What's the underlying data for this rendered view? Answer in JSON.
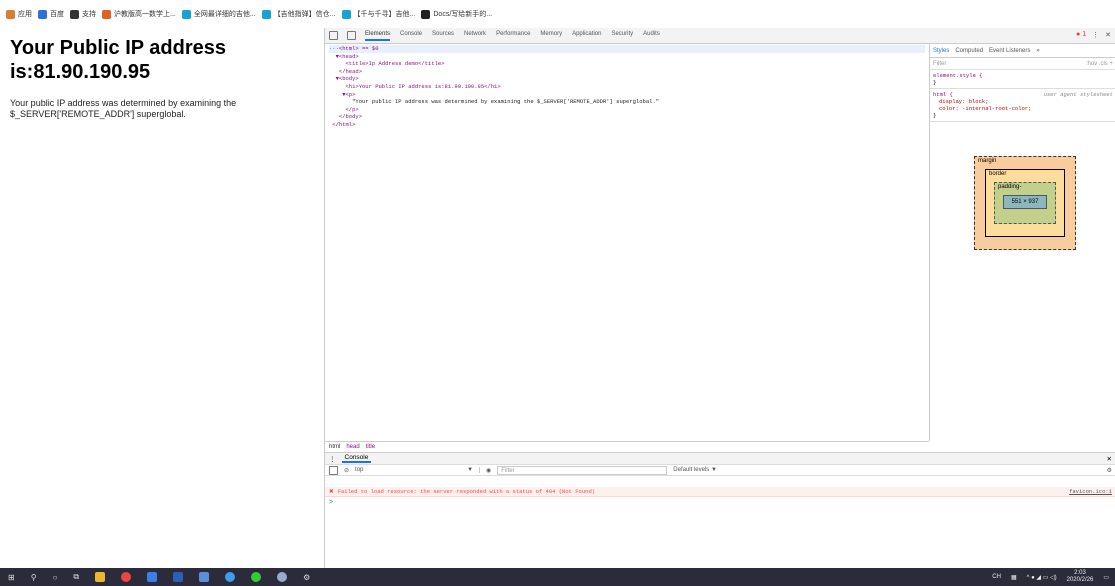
{
  "bookmarks": [
    {
      "label": "应用",
      "color": "#d88030"
    },
    {
      "label": "百度",
      "color": "#2f6fd8"
    },
    {
      "label": "支持",
      "color": "#333"
    },
    {
      "label": "沪教版高一数学上...",
      "color": "#e06020"
    },
    {
      "label": "全网最详细的吉他...",
      "color": "#1aa0d8"
    },
    {
      "label": "【吉他指弹】信仓...",
      "color": "#1aa0d8"
    },
    {
      "label": "【千与千寻】吉他...",
      "color": "#1aa0d8"
    },
    {
      "label": "Docs/写给新手的...",
      "color": "#222"
    }
  ],
  "page": {
    "heading": "Your Public IP address is:81.90.190.95",
    "paragraph": "Your public IP address was determined by examining the $_SERVER['REMOTE_ADDR'] superglobal."
  },
  "devtools": {
    "tabs": [
      "Elements",
      "Console",
      "Sources",
      "Network",
      "Performance",
      "Memory",
      "Application",
      "Security",
      "Audits"
    ],
    "error_count": "1",
    "tree": [
      "···<html> == $0",
      "  ▼<head>",
      "     <title>Ip Address demo</title>",
      "   </head>",
      "  ▼<body>",
      "     <h1>Your Public IP address is:81.90.190.95</h1>",
      "    ▼<p>",
      "       \"Your public IP address was determined by examining the $_SERVER['REMOTE_ADDR'] superglobal.\"",
      "     </p>",
      "   </body>",
      " </html>"
    ],
    "styles_tabs": [
      "Styles",
      "Computed",
      "Event Listeners",
      "»"
    ],
    "filter_placeholder": "Filter",
    "filter_right": ":hov  .cls  +",
    "rule1": "element.style {",
    "rule1_end": "}",
    "rule2_sel": "html {",
    "rule2_src": "user agent stylesheet",
    "rule2_p1": "display: block;",
    "rule2_p2": "color: -internal-root-color;",
    "rule2_end": "}",
    "box": {
      "margin": "margin",
      "border": "border",
      "padding": "padding-",
      "content": "551 × 937",
      "dash": "-"
    },
    "crumbs": [
      "html",
      "head",
      "title"
    ],
    "console": {
      "tab": "Console",
      "context": "top",
      "filter_placeholder": "Filter",
      "levels": "Default levels ▼",
      "error": "Failed to load resource: the server responded with a status of 404 (Not Found)",
      "error_src": "favicon.ico:1",
      "prompt": ">"
    }
  },
  "taskbar": {
    "ime": "CH",
    "time": "2:03",
    "date": "2020/2/26"
  }
}
